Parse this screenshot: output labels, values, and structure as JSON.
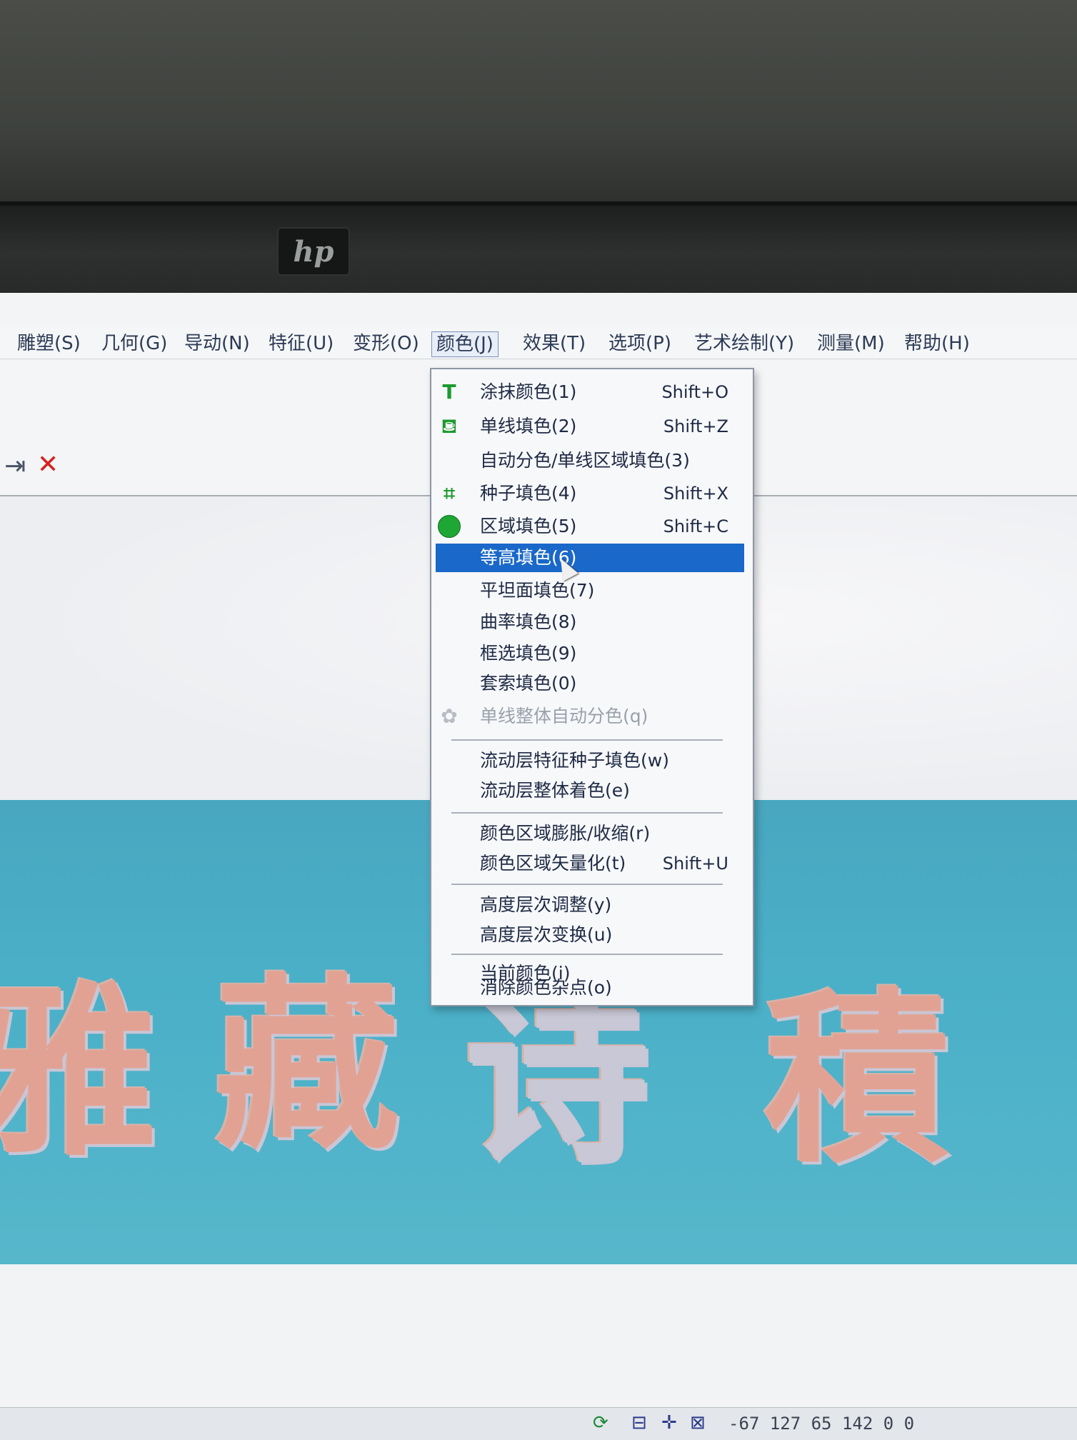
{
  "monitor": {
    "brand": "hp"
  },
  "menubar": {
    "items": [
      {
        "label": "雕塑(S)"
      },
      {
        "label": "几何(G)"
      },
      {
        "label": "导动(N)"
      },
      {
        "label": "特征(U)"
      },
      {
        "label": "变形(O)"
      },
      {
        "label": "颜色(J)"
      },
      {
        "label": "效果(T)"
      },
      {
        "label": "选项(P)"
      },
      {
        "label": "艺术绘制(Y)"
      },
      {
        "label": "测量(M)"
      },
      {
        "label": "帮助(H)"
      }
    ],
    "open_menu": "颜色(J)"
  },
  "toolbar": {
    "icons": [
      "indent-icon",
      "close-icon"
    ]
  },
  "color_menu": {
    "items": [
      {
        "label": "涂抹颜色(1)",
        "shortcut": "Shift+O",
        "icon": "brush-icon"
      },
      {
        "label": "单线填色(2)",
        "shortcut": "Shift+Z",
        "icon": "line-fill-icon"
      },
      {
        "label": "自动分色/单线区域填色(3)",
        "shortcut": ""
      },
      {
        "label": "种子填色(4)",
        "shortcut": "Shift+X",
        "icon": "seed-fill-icon"
      },
      {
        "label": "区域填色(5)",
        "shortcut": "Shift+C",
        "icon": "region-fill-icon"
      },
      {
        "label": "等高填色(6)",
        "shortcut": "",
        "selected": true
      },
      {
        "label": "平坦面填色(7)",
        "shortcut": ""
      },
      {
        "label": "曲率填色(8)",
        "shortcut": ""
      },
      {
        "label": "框选填色(9)",
        "shortcut": ""
      },
      {
        "label": "套索填色(0)",
        "shortcut": ""
      },
      {
        "label": "单线整体自动分色(q)",
        "shortcut": "",
        "disabled": true,
        "icon": "flower-icon"
      },
      {
        "label": "流动层特征种子填色(w)",
        "shortcut": ""
      },
      {
        "label": "流动层整体着色(e)",
        "shortcut": ""
      },
      {
        "label": "颜色区域膨胀/收缩(r)",
        "shortcut": ""
      },
      {
        "label": "颜色区域矢量化(t)",
        "shortcut": "Shift+U"
      },
      {
        "label": "高度层次调整(y)",
        "shortcut": ""
      },
      {
        "label": "高度层次变换(u)",
        "shortcut": ""
      },
      {
        "label": "当前颜色(i)",
        "shortcut": ""
      },
      {
        "label": "消除颜色杂点(o)",
        "shortcut": ""
      }
    ]
  },
  "relief": {
    "text": "雅藏诗積"
  },
  "statusbar": {
    "coords": "-67  127  65  142  0  0"
  },
  "colors": {
    "selection": "#1a68c9",
    "relief_bg": "#4ab0c8",
    "relief_text": "#e2a293",
    "icon_green": "#1c9a2e"
  }
}
